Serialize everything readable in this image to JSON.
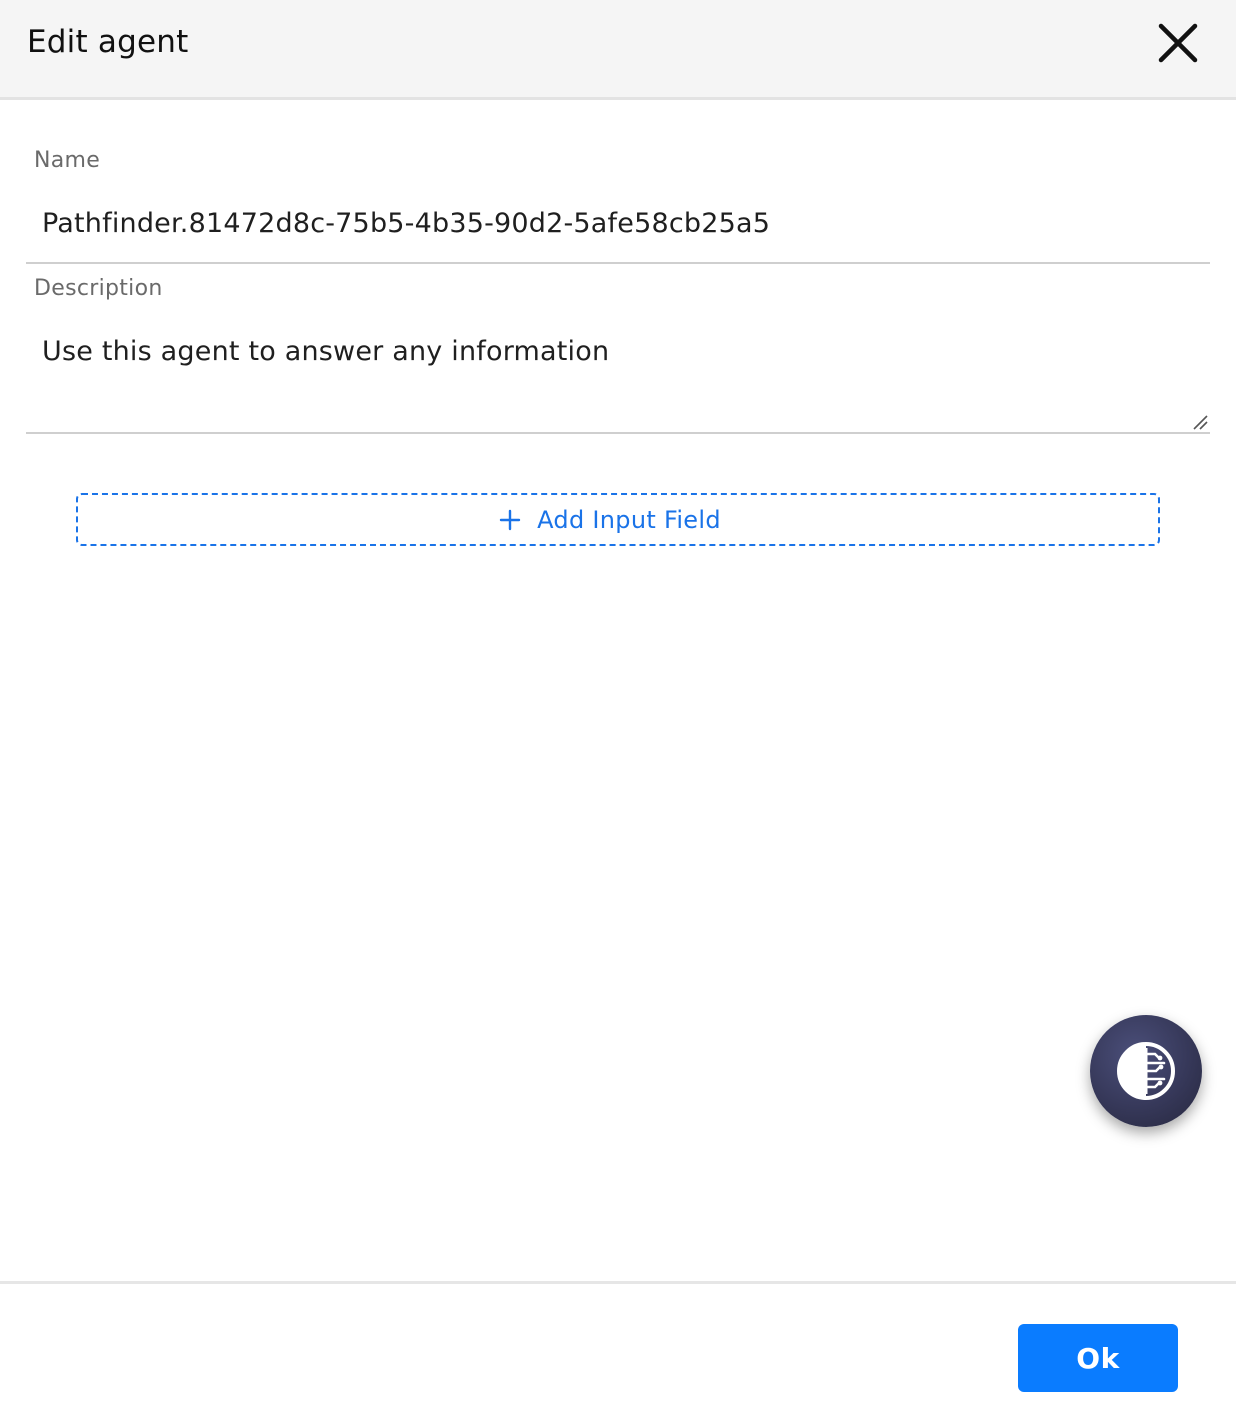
{
  "dialog": {
    "title": "Edit agent",
    "close_icon": "close-icon"
  },
  "form": {
    "name": {
      "label": "Name",
      "value": "Pathfinder.81472d8c-75b5-4b35-90d2-5afe58cb25a5"
    },
    "description": {
      "label": "Description",
      "value": "Use this agent to answer any information"
    },
    "add_input_field": {
      "label": "Add Input Field",
      "icon": "plus-icon"
    }
  },
  "assistant_fab": {
    "icon": "ai-brain-icon"
  },
  "footer": {
    "ok_label": "Ok"
  },
  "colors": {
    "accent": "#1a73e8",
    "primary_button": "#0a7cff",
    "header_bg": "#f5f5f5",
    "fab_bg": "#363859"
  }
}
